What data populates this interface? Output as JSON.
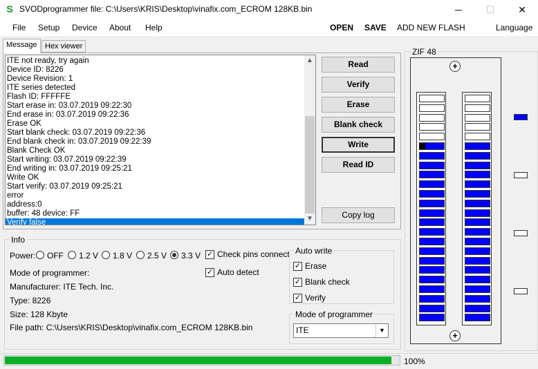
{
  "window": {
    "title": "SVODprogrammer file: C:\\Users\\KRIS\\Desktop\\vinafix.com_ECROM 128KB.bin",
    "icon_letter": "S",
    "minimize": "─",
    "maximize": "☐",
    "close": "✕"
  },
  "menu": {
    "items": [
      "File",
      "Setup",
      "Device",
      "About",
      "Help"
    ],
    "open": "OPEN",
    "save": "SAVE",
    "add_flash": "ADD NEW FLASH",
    "language": "Language"
  },
  "tabs": [
    "Message",
    "Hex viewer"
  ],
  "log": {
    "lines": [
      "ITE not ready, try again",
      "Device ID: 8226",
      "Device Revision: 1",
      "ITE series detected",
      "Flash ID: FFFFFE",
      "Start erase in: 03.07.2019 09:22:30",
      "End erase in: 03.07.2019 09:22:36",
      "Erase OK",
      "Start blank check: 03.07.2019 09:22:36",
      "End blank check in: 03.07.2019 09:22:39",
      "Blank Check OK",
      "Start writing: 03.07.2019 09:22:39",
      "End writing in: 03.07.2019 09:25:21",
      "Write OK",
      "Start verify: 03.07.2019 09:25:21",
      "error",
      "address:0",
      "buffer: 48 device: FF",
      "Verify false"
    ],
    "selected_index": 18
  },
  "buttons": {
    "read": "Read",
    "verify": "Verify",
    "erase": "Erase",
    "blank_check": "Blank check",
    "write": "Write",
    "read_id": "Read ID",
    "copy_log": "Copy log"
  },
  "info": {
    "legend": "Info",
    "power_label": "Power:",
    "power_options": [
      "OFF",
      "1.2 V",
      "1.8 V",
      "2.5 V",
      "3.3 V"
    ],
    "power_selected": "3.3 V",
    "check_pins": "Check pins connect",
    "auto_detect": "Auto detect",
    "mode_label": "Mode of programmer:",
    "manufacturer": "Manufacturer: ITE Tech. Inc.",
    "type": "Type: 8226",
    "size": "Size: 128 Kbyte",
    "file_path": "File path: C:\\Users\\KRIS\\Desktop\\vinafix.com_ECROM 128KB.bin"
  },
  "auto_write": {
    "legend": "Auto write",
    "erase": "Erase",
    "blank_check": "Blank check",
    "verify": "Verify"
  },
  "mode_of_programmer": {
    "legend": "Mode of programmer",
    "selected": "ITE"
  },
  "zif": {
    "legend": "ZIF 48",
    "pins_per_side": 24,
    "unused_top_rows": 5,
    "side_indicators": [
      "blue",
      "white",
      "white",
      "white"
    ]
  },
  "status": {
    "progress": 0.98,
    "percent_text": "100%"
  },
  "colors": {
    "selection": "#0078d7",
    "pin_active": "#0000ff",
    "progress": "#06b025",
    "icon_green": "#1f8f2a"
  }
}
